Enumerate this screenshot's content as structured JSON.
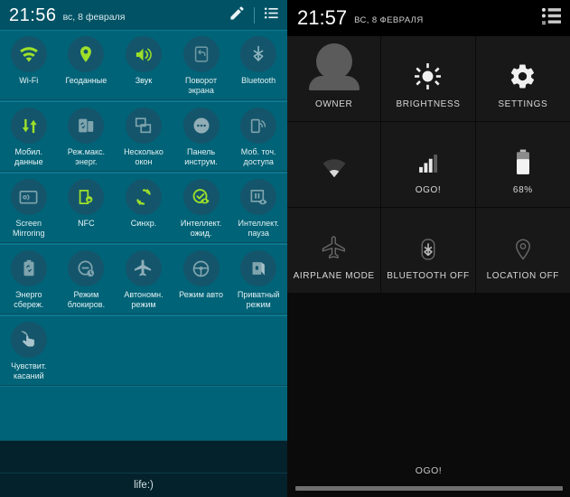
{
  "left_panel": {
    "status_bar": {
      "time": "21:56",
      "date": "вс, 8 февраля",
      "edit_icon": "pencil-icon",
      "list_icon": "list-icon"
    },
    "toggles": [
      [
        {
          "label": "Wi-Fi",
          "icon": "wifi-icon",
          "active": true
        },
        {
          "label": "Геоданные",
          "icon": "location-pin-icon",
          "active": true
        },
        {
          "label": "Звук",
          "icon": "sound-speaker-icon",
          "active": true
        },
        {
          "label": "Поворот экрана",
          "icon": "screen-rotation-icon",
          "active": false
        },
        {
          "label": "Bluetooth",
          "icon": "bluetooth-icon",
          "active": false
        }
      ],
      [
        {
          "label": "Мобил. данные",
          "icon": "mobile-data-icon",
          "active": true
        },
        {
          "label": "Реж.макс. энерг.",
          "icon": "ultra-power-saving-icon",
          "active": false
        },
        {
          "label": "Несколько окон",
          "icon": "multi-window-icon",
          "active": false
        },
        {
          "label": "Панель инструм.",
          "icon": "toolbox-icon",
          "active": false
        },
        {
          "label": "Моб. точ. доступа",
          "icon": "mobile-hotspot-icon",
          "active": false
        }
      ],
      [
        {
          "label": "Screen Mirroring",
          "icon": "screen-mirroring-icon",
          "active": false
        },
        {
          "label": "NFC",
          "icon": "nfc-icon",
          "active": true
        },
        {
          "label": "Синхр.",
          "icon": "sync-icon",
          "active": true
        },
        {
          "label": "Интеллект. ожид.",
          "icon": "smart-stay-icon",
          "active": true
        },
        {
          "label": "Интеллект. пауза",
          "icon": "smart-pause-icon",
          "active": false
        }
      ],
      [
        {
          "label": "Энерго сбереж.",
          "icon": "power-saving-icon",
          "active": false
        },
        {
          "label": "Режим блокиров.",
          "icon": "blocking-mode-icon",
          "active": false
        },
        {
          "label": "Автономн. режим",
          "icon": "airplane-mode-icon",
          "active": false
        },
        {
          "label": "Режим авто",
          "icon": "car-mode-icon",
          "active": false
        },
        {
          "label": "Приватный режим",
          "icon": "private-mode-icon",
          "active": false
        }
      ],
      [
        {
          "label": "Чувствит. касаний",
          "icon": "touch-sensitivity-icon",
          "active": false
        }
      ]
    ],
    "carrier": "life:)"
  },
  "right_panel": {
    "status_bar": {
      "time": "21:57",
      "date": "ВС, 8 ФЕВРАЛЯ",
      "quick_settings_icon": "quick-settings-list-icon"
    },
    "tiles": [
      [
        {
          "label": "OWNER",
          "icon": "user-avatar-icon"
        },
        {
          "label": "BRIGHTNESS",
          "icon": "brightness-sun-icon"
        },
        {
          "label": "SETTINGS",
          "icon": "settings-gear-icon"
        }
      ],
      [
        {
          "label": "",
          "icon": "wifi-off-icon"
        },
        {
          "label": "OGO!",
          "icon": "cell-signal-icon"
        },
        {
          "label": "68%",
          "icon": "battery-icon"
        }
      ],
      [
        {
          "label": "AIRPLANE MODE",
          "icon": "airplane-mode-icon"
        },
        {
          "label": "BLUETOOTH OFF",
          "icon": "bluetooth-off-icon"
        },
        {
          "label": "LOCATION OFF",
          "icon": "location-off-icon"
        }
      ]
    ],
    "carrier": "OGO!"
  },
  "colors": {
    "teal_bg": "#016377",
    "teal_statusbar": "#015265",
    "accent_green": "#9ee02a",
    "dark_bg": "#0b0b0b",
    "tile_bg": "#181818"
  }
}
